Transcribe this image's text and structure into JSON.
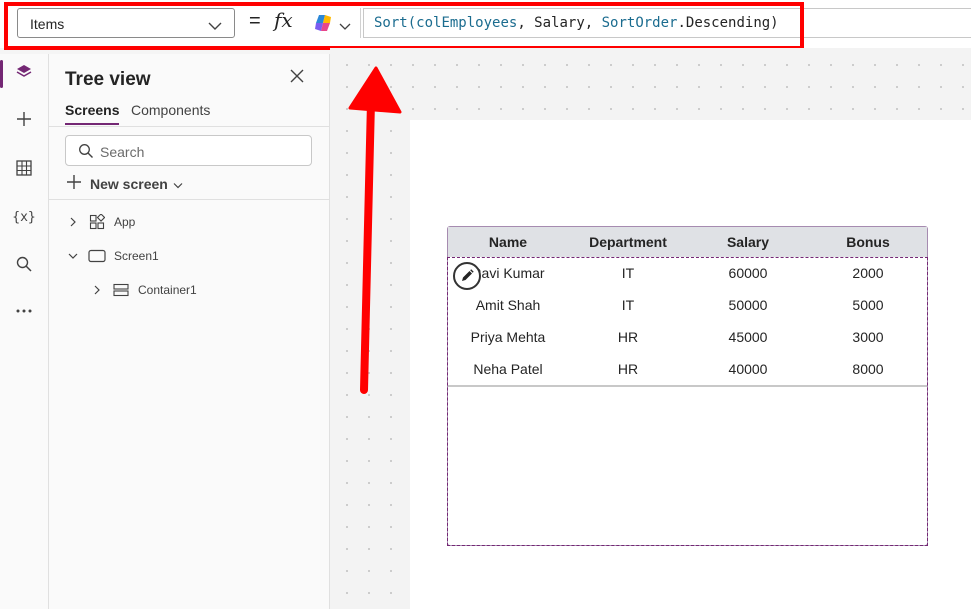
{
  "formula_bar": {
    "property": "Items",
    "equals": "=",
    "fx": "fx",
    "formula_tokens": [
      {
        "text": "Sort(",
        "cls": "tk-fn"
      },
      {
        "text": "colEmployees",
        "cls": "tk-id"
      },
      {
        "text": ", Salary, ",
        "cls": "tk-plain"
      },
      {
        "text": "SortOrder",
        "cls": "tk-enum"
      },
      {
        "text": ".Descending)",
        "cls": "tk-plain"
      }
    ]
  },
  "rail": {
    "icons": [
      "layers-icon",
      "plus-icon",
      "table-icon",
      "variables-icon",
      "search-icon",
      "more-icon"
    ],
    "variables_glyph": "{x}",
    "more_glyph": "…"
  },
  "tree": {
    "title": "Tree view",
    "tabs": [
      "Screens",
      "Components"
    ],
    "search_placeholder": "Search",
    "new_screen_label": "New screen",
    "nodes": [
      {
        "label": "App"
      },
      {
        "label": "Screen1"
      },
      {
        "label": "Container1"
      }
    ]
  },
  "gallery": {
    "columns": [
      "Name",
      "Department",
      "Salary",
      "Bonus"
    ],
    "rows": [
      [
        "Ravi Kumar",
        "IT",
        "60000",
        "2000"
      ],
      [
        "Amit Shah",
        "IT",
        "50000",
        "5000"
      ],
      [
        "Priya Mehta",
        "HR",
        "45000",
        "3000"
      ],
      [
        "Neha Patel",
        "HR",
        "40000",
        "8000"
      ]
    ]
  },
  "colors": {
    "accent": "#742774",
    "highlight": "#ff0000"
  }
}
